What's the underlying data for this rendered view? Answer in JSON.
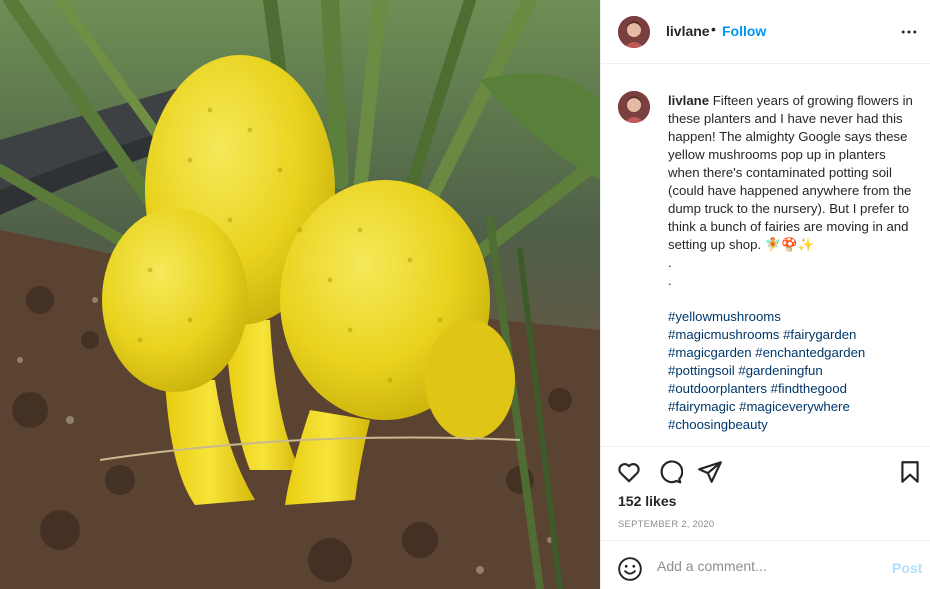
{
  "post": {
    "username": "livlane",
    "follow_label": "Follow",
    "separator": "•",
    "caption_username": "livlane",
    "caption_text": "Fifteen years of growing flowers in these planters and I have never had this happen! The almighty Google says these yellow mushrooms pop up in planters when there's contaminated potting soil (could have happened anywhere from the dump truck to the nursery). But I prefer to think a bunch of fairies are moving in and setting up shop. 🧚🍄✨",
    "caption_dot1": ".",
    "caption_dot2": ".",
    "hashtags": [
      "#yellowmushrooms",
      "#magicmushrooms",
      "#fairygarden",
      "#magicgarden",
      "#enchantedgarden",
      "#pottingsoil",
      "#gardeningfun",
      "#outdoorplanters",
      "#findthegood",
      "#fairymagic",
      "#magiceverywhere",
      "#choosingbeauty"
    ],
    "likes": "152 likes",
    "date": "SEPTEMBER 2, 2020"
  },
  "comment": {
    "placeholder": "Add a comment...",
    "post_label": "Post"
  },
  "icons": {
    "more": "more-horizontal-icon",
    "like": "heart-icon",
    "comment": "comment-bubble-icon",
    "share": "paper-plane-icon",
    "save": "bookmark-icon",
    "emoji": "smiley-icon"
  },
  "colors": {
    "follow": "#0095f6",
    "hashtag": "#00376b",
    "muted": "#8e8e8e",
    "post_disabled": "#b2dffc"
  }
}
